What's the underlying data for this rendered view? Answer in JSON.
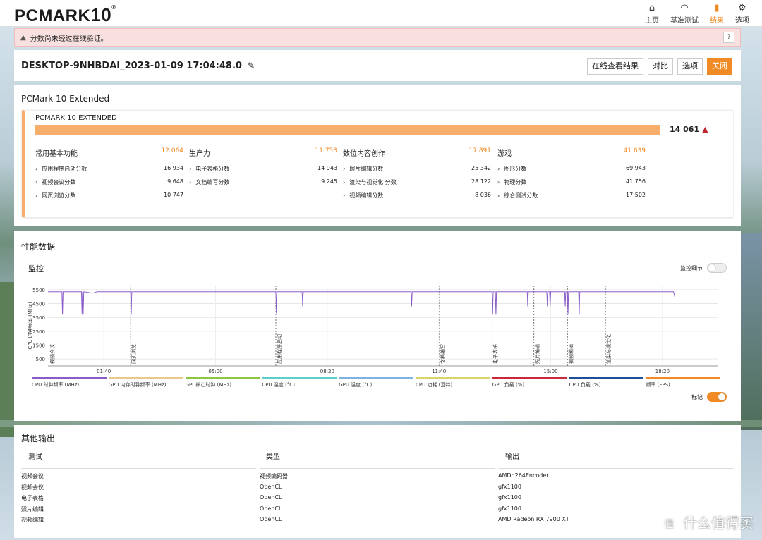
{
  "app": {
    "logo": "PCMARK",
    "logo_num": "10",
    "logo_reg": "®"
  },
  "nav": [
    {
      "label": "主页",
      "icon": "home-icon",
      "glyph": "⌂",
      "active": false
    },
    {
      "label": "基准测试",
      "icon": "gauge-icon",
      "glyph": "◠",
      "active": false
    },
    {
      "label": "结果",
      "icon": "bar-chart-icon",
      "glyph": "▮",
      "active": true
    },
    {
      "label": "选项",
      "icon": "gear-icon",
      "glyph": "⚙",
      "active": false
    }
  ],
  "warning": {
    "text": "分数尚未经过在线验证。",
    "help": "?"
  },
  "result": {
    "name": "DESKTOP-9NHBDAI_2023-01-09 17:04:48.0",
    "buttons": {
      "view_online": "在线查看结果",
      "compare": "对比",
      "options": "选项",
      "close": "关闭"
    }
  },
  "score": {
    "title": "PCMark 10 Extended",
    "label": "PCMARK 10 EXTENDED",
    "total": "14 061",
    "bar_fraction": 1.0,
    "categories": [
      {
        "name": "常用基本功能",
        "value": "12 064",
        "subs": [
          {
            "name": "应用程序启动分数",
            "value": "16 934"
          },
          {
            "name": "视频会议分数",
            "value": "9 648"
          },
          {
            "name": "网页浏览分数",
            "value": "10 747"
          }
        ]
      },
      {
        "name": "生产力",
        "value": "11 753",
        "subs": [
          {
            "name": "电子表格分数",
            "value": "14 943"
          },
          {
            "name": "文档编写分数",
            "value": "9 245"
          }
        ]
      },
      {
        "name": "数位内容创作",
        "value": "17 891",
        "subs": [
          {
            "name": "照片编辑分数",
            "value": "25 342"
          },
          {
            "name": "渲染与视觉化 分数",
            "value": "28 122"
          },
          {
            "name": "视频编辑分数",
            "value": "8 036"
          }
        ]
      },
      {
        "name": "游戏",
        "value": "41 639",
        "subs": [
          {
            "name": "图形分数",
            "value": "69 943"
          },
          {
            "name": "物理分数",
            "value": "41 756"
          },
          {
            "name": "综合测试分数",
            "value": "17 502"
          }
        ]
      }
    ]
  },
  "perf": {
    "title": "性能数据",
    "monitor": "监控",
    "detail_toggle": "监控细节",
    "detail_on": false,
    "mark_toggle": "标记",
    "mark_on": true
  },
  "chart_data": {
    "type": "line",
    "ylabel": "CPU 时钟频率 (MHz)",
    "y_ticks": [
      5500,
      4500,
      3500,
      2500,
      1500,
      500
    ],
    "ylim": [
      0,
      5800
    ],
    "x_ticks": [
      "01:40",
      "05:00",
      "08:20",
      "11:40",
      "15:00",
      "18:20"
    ],
    "x_tick_minutes": [
      100,
      300,
      500,
      700,
      900,
      1100
    ],
    "xlim": [
      0,
      1200
    ],
    "grid": true,
    "series": [
      {
        "name": "CPU 时钟频率 (MHz)",
        "color": "#8a5cc7",
        "points": [
          [
            0,
            5350
          ],
          [
            25,
            5350
          ],
          [
            26,
            3700
          ],
          [
            27,
            5350
          ],
          [
            60,
            5350
          ],
          [
            61,
            3700
          ],
          [
            62,
            5350
          ],
          [
            63,
            3700
          ],
          [
            64,
            5350
          ],
          [
            80,
            5250
          ],
          [
            88,
            5350
          ],
          [
            148,
            5350
          ],
          [
            149,
            3700
          ],
          [
            150,
            5350
          ],
          [
            408,
            5350
          ],
          [
            409,
            3800
          ],
          [
            410,
            5350
          ],
          [
            455,
            5350
          ],
          [
            456,
            4300
          ],
          [
            457,
            5350
          ],
          [
            650,
            5350
          ],
          [
            651,
            4300
          ],
          [
            652,
            5350
          ],
          [
            795,
            5350
          ],
          [
            796,
            3700
          ],
          [
            797,
            5350
          ],
          [
            801,
            5350
          ],
          [
            802,
            3700
          ],
          [
            803,
            5350
          ],
          [
            858,
            5350
          ],
          [
            859,
            4300
          ],
          [
            860,
            5350
          ],
          [
            893,
            5350
          ],
          [
            894,
            4300
          ],
          [
            895,
            5350
          ],
          [
            898,
            5350
          ],
          [
            899,
            4300
          ],
          [
            900,
            5350
          ],
          [
            925,
            5350
          ],
          [
            926,
            4300
          ],
          [
            927,
            5350
          ],
          [
            930,
            5350
          ],
          [
            931,
            3700
          ],
          [
            932,
            5350
          ],
          [
            950,
            5350
          ],
          [
            951,
            3700
          ],
          [
            952,
            5350
          ],
          [
            1120,
            5350
          ],
          [
            1122,
            5000
          ]
        ]
      }
    ],
    "markers": [
      {
        "x": 2,
        "label": "视频会议"
      },
      {
        "x": 148,
        "label": "网页浏览"
      },
      {
        "x": 408,
        "label": "应用程序启动"
      },
      {
        "x": 701,
        "label": "文档编写"
      },
      {
        "x": 795,
        "label": "电子表格"
      },
      {
        "x": 870,
        "label": "照片编辑"
      },
      {
        "x": 930,
        "label": "视频编辑"
      },
      {
        "x": 998,
        "label": "渲染与视觉化"
      }
    ]
  },
  "legend": [
    {
      "label": "CPU 时钟频率 (MHz)",
      "color": "#8a5cc7"
    },
    {
      "label": "GPU 内存时钟频率 (MHz)",
      "color": "#e9c98a"
    },
    {
      "label": "GPU核心时钟 (MHz)",
      "color": "#8dc63f"
    },
    {
      "label": "CPU 温度 (°C)",
      "color": "#5ad0c6"
    },
    {
      "label": "GPU 温度 (°C)",
      "color": "#7fb2e0"
    },
    {
      "label": "CPU 功耗 (瓦特)",
      "color": "#d9d36a"
    },
    {
      "label": "GPU 负载 (%)",
      "color": "#c8283a"
    },
    {
      "label": "CPU 负载 (%)",
      "color": "#1f4f9a"
    },
    {
      "label": "帧率 (FPS)",
      "color": "#f08a24"
    }
  ],
  "other": {
    "title": "其他输出",
    "headers": [
      "测试",
      "类型",
      "输出"
    ],
    "rows": [
      [
        "视频会议",
        "视频编码器",
        "AMDh264Encoder"
      ],
      [
        "视频会议",
        "OpenCL",
        "gfx1100"
      ],
      [
        "电子表格",
        "OpenCL",
        "gfx1100"
      ],
      [
        "照片编辑",
        "OpenCL",
        "gfx1100"
      ],
      [
        "视频编辑",
        "OpenCL",
        "AMD Radeon RX 7900 XT"
      ]
    ]
  },
  "watermark": {
    "glyph": "值",
    "text": "什么值得买"
  }
}
